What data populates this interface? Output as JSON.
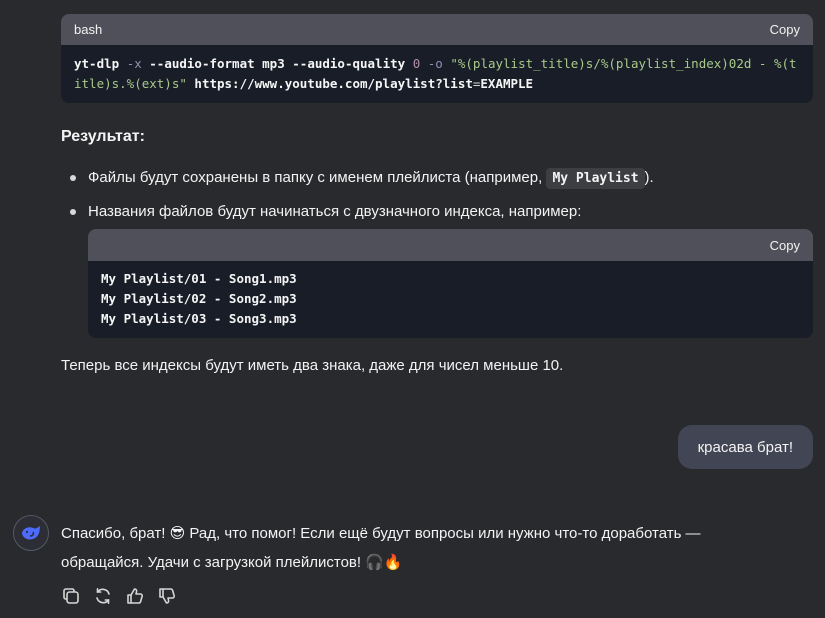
{
  "code_block_1": {
    "lang": "bash",
    "copy_label": "Copy",
    "tokens": {
      "cmd": "yt-dlp ",
      "f1": "-x",
      "p1": " --audio-format mp3 --audio-quality ",
      "n1": "0",
      "sp": " ",
      "f2": "-o",
      "sp2": " ",
      "s1": "\"%(playlist_title)s/%(playlist_index)02d - %(t",
      "s2": "itle)s.%(ext)s\"",
      "url1": " https://www.youtube.com/playlist?list",
      "eq": "=",
      "url2": "EXAMPLE"
    }
  },
  "result_heading": "Результат:",
  "bullets": {
    "b1_text": "Файлы будут сохранены в папку с именем плейлиста (например, ",
    "b1_code": "My Playlist",
    "b1_end": ").",
    "b2_text": "Названия файлов будут начинаться с двузначного индекса, например:"
  },
  "code_block_2": {
    "copy_label": "Copy",
    "lines": [
      "My Playlist/01 - Song1.mp3",
      "My Playlist/02 - Song2.mp3",
      "My Playlist/03 - Song3.mp3"
    ]
  },
  "summary_text": "Теперь все индексы будут иметь два знака, даже для чисел меньше 10.",
  "user_message": "красава брат!",
  "assistant_reply": {
    "line1_a": "Спасибо, брат! ",
    "emoji_cool": "😎",
    "line1_b": " Рад, что помог! Если ещё будут вопросы или нужно что-то доработать —",
    "line2_a": "обращайся. Удачи с загрузкой плейлистов! ",
    "emoji_headphones": "🎧",
    "emoji_fire": "🔥"
  },
  "icons": {
    "avatar": "whale-logo-icon",
    "copy": "copy-icon",
    "regenerate": "refresh-icon",
    "like": "thumbs-up-icon",
    "dislike": "thumbs-down-icon"
  },
  "colors": {
    "background": "#292a2d",
    "code_header": "#50505a",
    "code_body": "#181d28",
    "user_bubble": "#424654",
    "accent_blue": "#4d6bfe"
  }
}
